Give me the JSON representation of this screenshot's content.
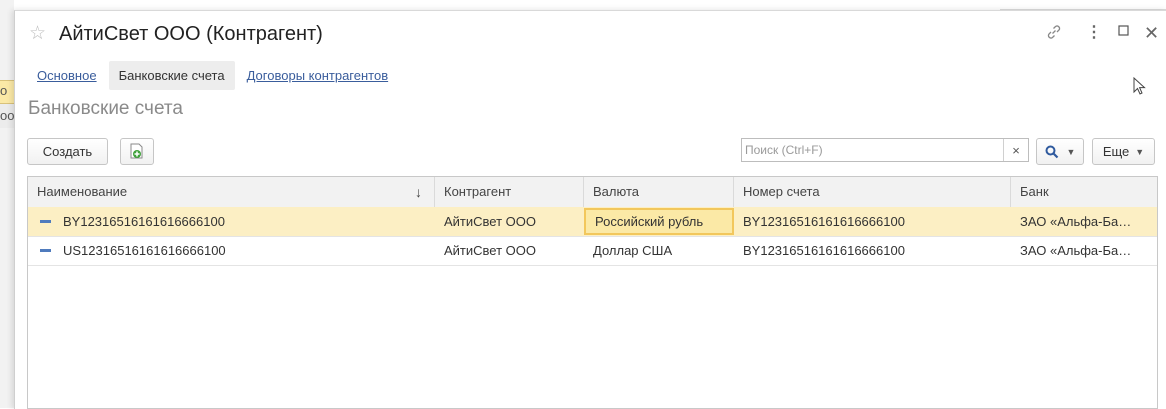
{
  "background": {
    "fragment_1": "о",
    "fragment_2": "оо"
  },
  "window": {
    "title": "АйтиСвет ООО (Контрагент)",
    "icons": [
      "star-icon",
      "link-icon",
      "more-icon",
      "maximize-icon",
      "close-icon"
    ]
  },
  "tabs": [
    {
      "label": "Основное",
      "active": false
    },
    {
      "label": "Банковские счета",
      "active": true
    },
    {
      "label": "Договоры контрагентов",
      "active": false
    }
  ],
  "section_title": "Банковские счета",
  "toolbar": {
    "create_label": "Создать",
    "search_placeholder": "Поиск (Ctrl+F)",
    "search_clear": "×",
    "more_label": "Еще"
  },
  "table": {
    "columns": [
      "Наименование",
      "Контрагент",
      "Валюта",
      "Номер счета",
      "Банк"
    ],
    "sort_indicator": "↓",
    "rows": [
      {
        "name": "BY12316516161616666100",
        "counterparty": "АйтиСвет ООО",
        "currency": "Российский рубль",
        "account": "BY12316516161616666100",
        "bank": "ЗАО «Альфа-Ба…",
        "selected": true
      },
      {
        "name": "US12316516161616666100",
        "counterparty": "АйтиСвет ООО",
        "currency": "Доллар США",
        "account": "BY12316516161616666100",
        "bank": "ЗАО «Альфа-Ба…",
        "selected": false
      }
    ]
  },
  "colors": {
    "selected_row": "#fcefc4",
    "focused_cell_border": "#f2c75c",
    "link": "#3a5d9c",
    "row_marker": "#4f7bbd"
  }
}
